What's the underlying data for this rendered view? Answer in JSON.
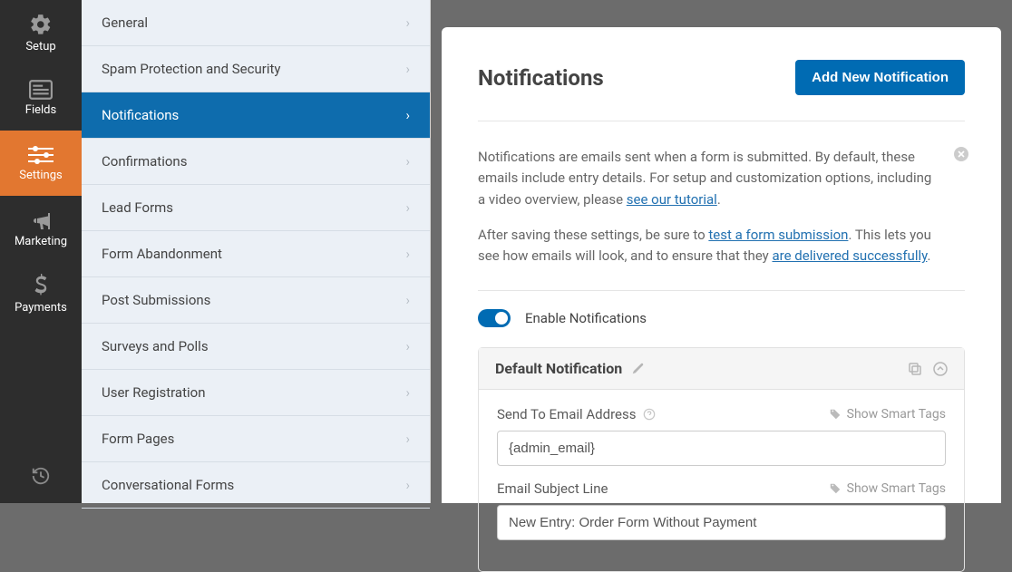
{
  "rail": {
    "items": [
      {
        "label": "Setup"
      },
      {
        "label": "Fields"
      },
      {
        "label": "Settings"
      },
      {
        "label": "Marketing"
      },
      {
        "label": "Payments"
      }
    ]
  },
  "sidebar": {
    "items": [
      {
        "label": "General"
      },
      {
        "label": "Spam Protection and Security"
      },
      {
        "label": "Notifications"
      },
      {
        "label": "Confirmations"
      },
      {
        "label": "Lead Forms"
      },
      {
        "label": "Form Abandonment"
      },
      {
        "label": "Post Submissions"
      },
      {
        "label": "Surveys and Polls"
      },
      {
        "label": "User Registration"
      },
      {
        "label": "Form Pages"
      },
      {
        "label": "Conversational Forms"
      }
    ]
  },
  "main": {
    "title": "Notifications",
    "add_button": "Add New Notification",
    "info_p1_a": "Notifications are emails sent when a form is submitted. By default, these emails include entry details. For setup and customization options, including a video overview, please ",
    "info_p1_link": "see our tutorial",
    "info_p1_b": ".",
    "info_p2_a": "After saving these settings, be sure to ",
    "info_p2_link1": "test a form submission",
    "info_p2_b": ". This lets you see how emails will look, and to ensure that they ",
    "info_p2_link2": "are delivered successfully",
    "info_p2_c": ".",
    "toggle_label": "Enable Notifications",
    "card": {
      "title": "Default Notification",
      "fields": [
        {
          "label": "Send To Email Address",
          "smart": "Show Smart Tags",
          "value": "{admin_email}",
          "help": true
        },
        {
          "label": "Email Subject Line",
          "smart": "Show Smart Tags",
          "value": "New Entry: Order Form Without Payment",
          "help": false
        }
      ]
    }
  }
}
